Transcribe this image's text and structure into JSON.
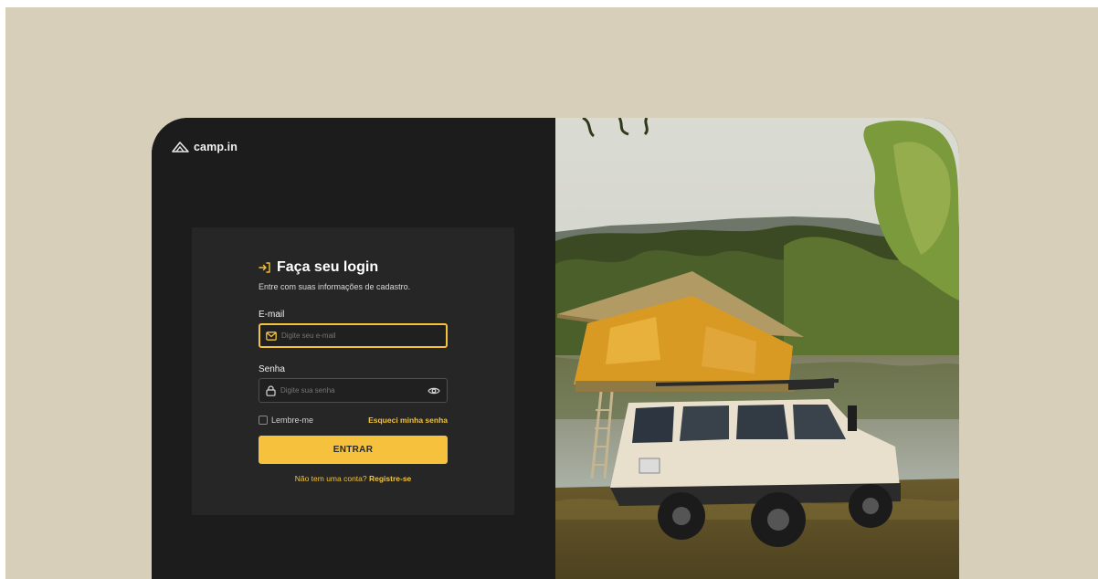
{
  "brand": {
    "name": "camp.in",
    "logo_icon": "tent-mountain-icon"
  },
  "login": {
    "title": "Faça seu login",
    "title_icon": "login-arrow-icon",
    "subtitle": "Entre com suas informações de cadastro.",
    "email": {
      "label": "E-mail",
      "placeholder": "Digite seu e-mail",
      "icon": "mail-icon"
    },
    "password": {
      "label": "Senha",
      "placeholder": "Digite sua senha",
      "icon": "lock-icon",
      "toggle_icon": "eye-icon"
    },
    "remember_label": "Lembre-me",
    "forgot_label": "Esqueci minha senha",
    "submit_label": "ENTRAR",
    "signup_prompt": "Não tem uma conta?",
    "signup_link": "Registre-se"
  },
  "hero_image": {
    "description_icon": "camping-truck-photo"
  },
  "colors": {
    "accent": "#f6c23d",
    "backdrop": "#d8cfba",
    "card": "#1c1c1c",
    "panel": "#262626"
  }
}
